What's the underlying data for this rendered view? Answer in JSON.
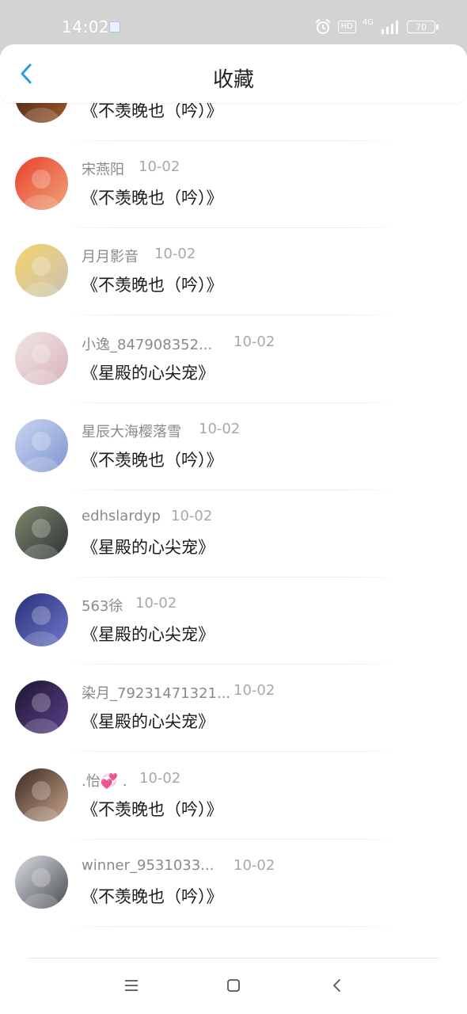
{
  "status_bar": {
    "time": "14:02",
    "hd_label": "HD",
    "network_label": "4G",
    "battery": "70",
    "icons": [
      "app-icon",
      "alarm-icon",
      "hd-icon",
      "signal-icon",
      "battery-icon"
    ]
  },
  "header": {
    "title": "收藏",
    "back_icon": "chevron-left-icon",
    "accent_color": "#2a9de2"
  },
  "items": [
    {
      "username": "",
      "date": "",
      "title": "《不羡晚也（吟）》",
      "avatar_colors": [
        "#3a1d12",
        "#a05a2c"
      ]
    },
    {
      "username": "宋燕阳",
      "date": "10-02",
      "title": "《不羡晚也（吟）》",
      "avatar_colors": [
        "#e8412c",
        "#f0a37a"
      ]
    },
    {
      "username": "月月影音",
      "date": "10-02",
      "title": "《不羡晚也（吟）》",
      "avatar_colors": [
        "#f6d36a",
        "#c9c2b6"
      ]
    },
    {
      "username": "小逸_847908352...",
      "date": "10-02",
      "title": "《星殿的心尖宠》",
      "avatar_colors": [
        "#f1e6e6",
        "#d8b3bb"
      ]
    },
    {
      "username": "星辰大海樱落雪",
      "date": "10-02",
      "title": "《不羡晚也（吟）》",
      "avatar_colors": [
        "#c9d6f2",
        "#7f95cf"
      ]
    },
    {
      "username": "edhslardyp",
      "date": "10-02",
      "title": "《星殿的心尖宠》",
      "avatar_colors": [
        "#7d8a6a",
        "#2e3238"
      ]
    },
    {
      "username": "563徐",
      "date": "10-02",
      "title": "《星殿的心尖宠》",
      "avatar_colors": [
        "#2a2f7a",
        "#6d78c9"
      ]
    },
    {
      "username": "染月_79231471321...",
      "date": "10-02",
      "title": "《星殿的心尖宠》",
      "avatar_colors": [
        "#1d1530",
        "#5b3f8a"
      ]
    },
    {
      "username": ".怡💞 .",
      "date": "10-02",
      "title": "《不羡晚也（吟）》",
      "avatar_colors": [
        "#3a2a22",
        "#c9a48a"
      ]
    },
    {
      "username": "winner_9531033...",
      "date": "10-02",
      "title": "《不羡晚也（吟）》",
      "avatar_colors": [
        "#d9dde2",
        "#4a4c52"
      ]
    }
  ],
  "nav_bar": {
    "buttons": [
      "menu-icon",
      "home-square-icon",
      "back-triangle-icon"
    ]
  }
}
